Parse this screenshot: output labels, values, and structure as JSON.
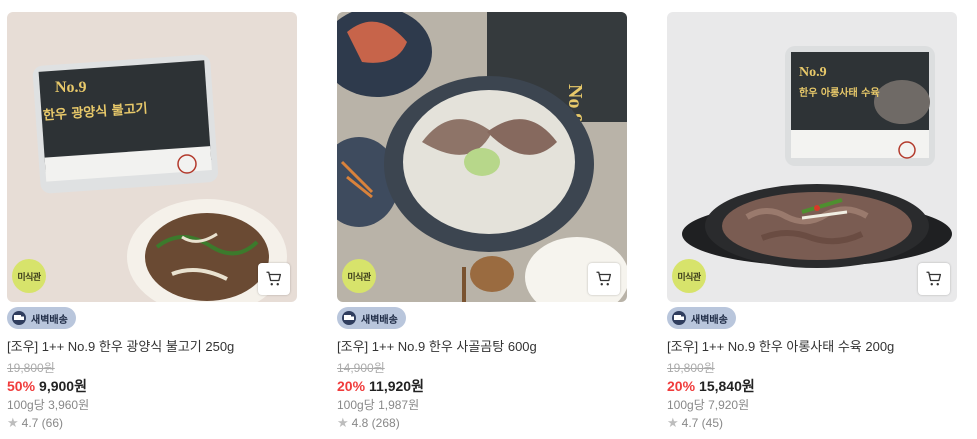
{
  "products": [
    {
      "badge": "미식관",
      "delivery": "새벽배송",
      "package_text": [
        "No.9",
        "한우 광양식 불고기"
      ],
      "title": "[조우] 1++ No.9 한우 광양식 불고기 250g",
      "original_price": "19,800원",
      "discount": "50%",
      "price": "9,900원",
      "unit_price": "100g당 3,960원",
      "rating": "4.7 (66)"
    },
    {
      "badge": "미식관",
      "delivery": "새벽배송",
      "package_text": [
        "No.9"
      ],
      "title": "[조우] 1++ No.9 한우 사골곰탕 600g",
      "original_price": "14,900원",
      "discount": "20%",
      "price": "11,920원",
      "unit_price": "100g당 1,987원",
      "rating": "4.8 (268)"
    },
    {
      "badge": "미식관",
      "delivery": "새벽배송",
      "package_text": [
        "No.9",
        "한우 아롱사태 수육"
      ],
      "title": "[조우] 1++ No.9 한우 아롱사태 수육 200g",
      "original_price": "19,800원",
      "discount": "20%",
      "price": "15,840원",
      "unit_price": "100g당 7,920원",
      "rating": "4.7 (45)"
    }
  ],
  "colors": {
    "discount": "#f03c3c",
    "badge_bg": "#d7e36b",
    "delivery_bg": "#b9c6dc",
    "package_accent": "#e8c96a"
  },
  "icons": [
    "cart-icon",
    "truck-icon",
    "star-icon"
  ]
}
